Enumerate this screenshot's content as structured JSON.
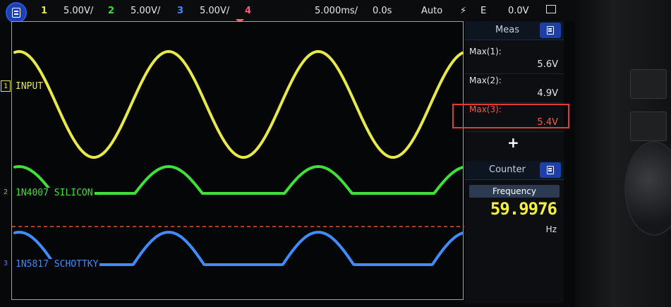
{
  "topbar": {
    "ch1_num": "1",
    "ch1_scale": "5.00V/",
    "ch2_num": "2",
    "ch2_scale": "5.00V/",
    "ch3_num": "3",
    "ch3_scale": "5.00V/",
    "ch4_num": "4",
    "timebase": "5.000ms/",
    "delay": "0.0s",
    "trigger_mode": "Auto",
    "trigger_source": "E",
    "trigger_level": "0.0V"
  },
  "channels": [
    {
      "num": "1",
      "label": "INPUT",
      "color": "#e8e84a"
    },
    {
      "num": "2",
      "label": "1N4007 SILICON",
      "color": "#3fe03a"
    },
    {
      "num": "3",
      "label": "1N5817 SCHOTTKY",
      "color": "#3f8cff"
    }
  ],
  "meas": {
    "title": "Meas",
    "items": [
      {
        "label": "Max(1):",
        "value": "5.6V"
      },
      {
        "label": "Max(2):",
        "value": "4.9V"
      },
      {
        "label": "Max(3):",
        "value": "5.4V"
      }
    ],
    "add": "+"
  },
  "counter": {
    "title": "Counter",
    "button": "Frequency",
    "value": "59.9976",
    "unit": "Hz"
  },
  "colors": {
    "ch1": "#e8e84a",
    "ch2": "#3fe03a",
    "ch3": "#3f8cff",
    "ch4": "#ff5c7a",
    "highlight": "#e23b34",
    "panel_accent": "#1c3faa",
    "trigger_line": "#d9532e"
  },
  "icons": [
    "menu-icon",
    "trigger-edge-icon",
    "display-icon",
    "panel-menu-icon",
    "ground-marker-icon"
  ]
}
